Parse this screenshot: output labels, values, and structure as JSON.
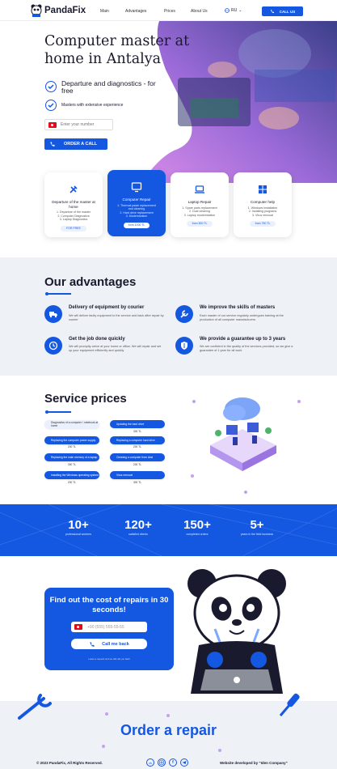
{
  "header": {
    "logo": "PandaFix",
    "nav": [
      "Main",
      "Advantages",
      "Prices",
      "About Us"
    ],
    "lang": "RU",
    "call_label": "CALL US"
  },
  "hero": {
    "title": "Computer master at home in Antalya",
    "feature1": "Departure and diagnostics - for free",
    "feature2": "Masters with extensive experience",
    "phone_placeholder": "Enter your number",
    "order_label": "ORDER A CALL"
  },
  "services": [
    {
      "title": "Departure of the master at home",
      "items": [
        "1. Departure of the master",
        "2. Computer Diagnostics",
        "3. Laptop Diagnostics"
      ],
      "price": "FOR FREE",
      "icon": "tools-icon"
    },
    {
      "title": "Computer Repair",
      "items": [
        "1. Thermal paste replacement",
        "and cleaning",
        "2. Hard drive replacement",
        "3. Modernization"
      ],
      "price": "from 1000 TL",
      "icon": "monitor-icon"
    },
    {
      "title": "Laptop Repair",
      "items": [
        "1. Spare parts replacement",
        "2. Dust cleaning",
        "3. Laptop modernization"
      ],
      "price": "from 500 TL",
      "icon": "laptop-icon"
    },
    {
      "title": "Computer help",
      "items": [
        "1. Windows installation",
        "2. Installing programs",
        "3. Virus removal"
      ],
      "price": "from 750 TL",
      "icon": "windows-icon"
    }
  ],
  "advantages": {
    "title": "Our advantages",
    "items": [
      {
        "title": "Delivery of equipment by courier",
        "desc": "We will deliver faulty equipment to the service and back after repair by courier",
        "icon": "truck-icon"
      },
      {
        "title": "We improve the skills of masters",
        "desc": "Each master of our service regularly undergoes training at the production of all computer manufacturers",
        "icon": "wrench-icon"
      },
      {
        "title": "Get the job done quickly",
        "desc": "We will promptly arrive at your home or office. We will repair and set up your equipment efficiently and quickly",
        "icon": "clock-icon"
      },
      {
        "title": "We provide a guarantee up to 3 years",
        "desc": "We are confident in the quality of the services provided, so we give a guarantee of 1 year for all work",
        "icon": "shield-icon"
      }
    ]
  },
  "prices": {
    "title": "Service prices",
    "left": [
      {
        "label": "Diagnostics of a computer / notebook at home",
        "price": ""
      },
      {
        "label": "Replacing the computer power supply",
        "price": "200 TL"
      },
      {
        "label": "Replacing the main memory of a laptop",
        "price": "300 TL"
      },
      {
        "label": "Installing the Windows operating system",
        "price": "200 TL"
      }
    ],
    "right": [
      {
        "label": "Updating the hard drive",
        "price": "300 TL"
      },
      {
        "label": "Replacing a computer hard drive",
        "price": "200 TL"
      },
      {
        "label": "Cleaning a computer from dust",
        "price": "200 TL"
      },
      {
        "label": "Virus removal",
        "price": "300 TL"
      }
    ]
  },
  "stats": [
    {
      "num": "10+",
      "label": "professional workers"
    },
    {
      "num": "120+",
      "label": "satisfied clients"
    },
    {
      "num": "150+",
      "label": "completed orders"
    },
    {
      "num": "5+",
      "label": "years in the field business"
    }
  ],
  "quote": {
    "title": "Find out the cost of repairs in 30 seconds!",
    "phone_value": "+90 (555) 555-55-55",
    "button": "Call me back",
    "note": "Leave a request and we will call you back"
  },
  "footer": {
    "order_title": "Order a repair",
    "copyright": "© 2023 PandaFix, All Rights Reserved.",
    "developer": "Website developed by \"Iden Company\""
  },
  "colors": {
    "accent": "#1457e0",
    "purple": "#c7a1f0",
    "light_bg": "#eef1f6"
  }
}
